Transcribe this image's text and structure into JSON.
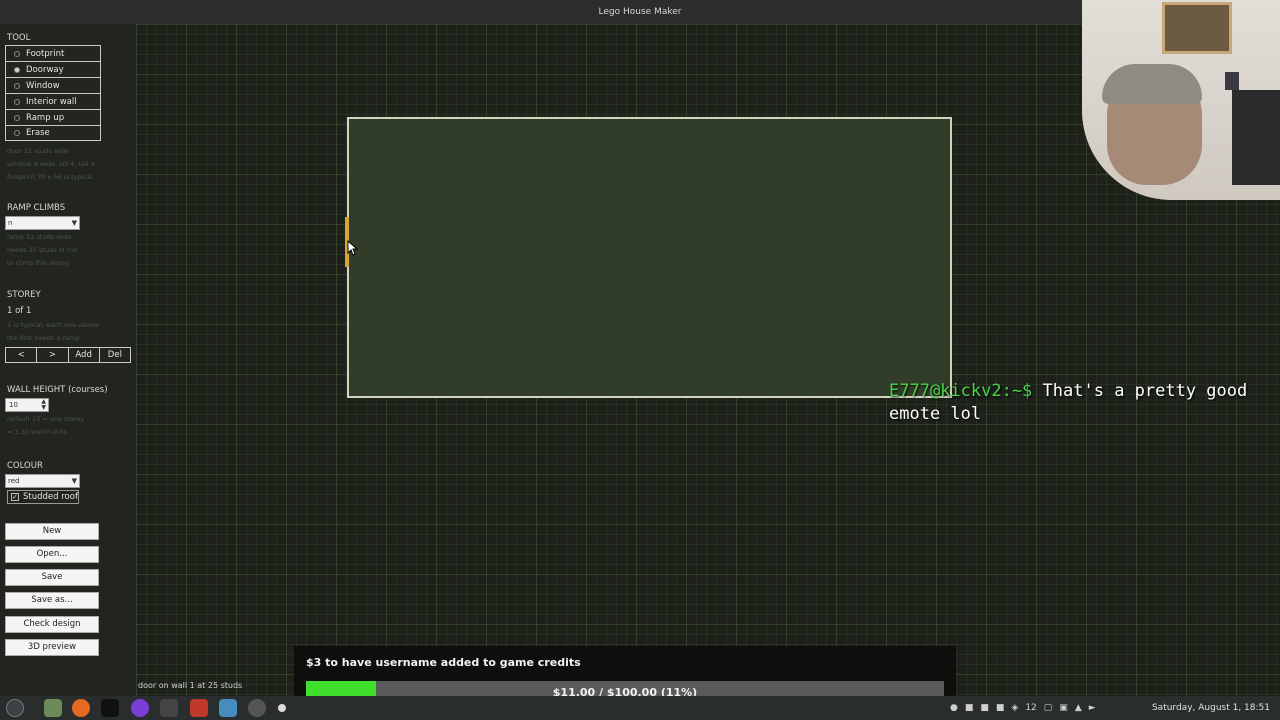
{
  "window": {
    "title": "Lego House Maker"
  },
  "tool": {
    "heading": "TOOL",
    "options": [
      {
        "label": "Footprint",
        "selected": false
      },
      {
        "label": "Doorway",
        "selected": true
      },
      {
        "label": "Window",
        "selected": false
      },
      {
        "label": "Interior wall",
        "selected": false
      },
      {
        "label": "Ramp up",
        "selected": false
      },
      {
        "label": "Erase",
        "selected": false
      }
    ],
    "hints": [
      "door 12 studs wide",
      "window 8 wide, sill 4, tall 4",
      "footprint 70 x 56 is typical"
    ]
  },
  "ramp": {
    "heading": "RAMP CLIMBS",
    "select_value": "n",
    "hints": [
      "ramp 12 studs wide",
      "needs 25 studs of run",
      "to climb this storey"
    ]
  },
  "storey": {
    "heading": "STOREY",
    "value": "1 of 1",
    "hints": [
      "2 is typical: each one above",
      "the first needs a ramp"
    ],
    "buttons": {
      "prev": "<",
      "next": ">",
      "add": "Add",
      "del": "Del"
    }
  },
  "wall_height": {
    "heading": "WALL HEIGHT (courses)",
    "value": "10",
    "hints": [
      "default 10 = one storey",
      "= 3.20 world units"
    ]
  },
  "colour": {
    "heading": "COLOUR",
    "value": "red",
    "studded_roof_label": "Studded roof",
    "studded_roof_checked": true
  },
  "actions": {
    "new": "New",
    "open": "Open...",
    "save": "Save",
    "save_as": "Save as...",
    "check": "Check design",
    "preview": "3D preview"
  },
  "status_text": "door on wall 1 at 25 studs",
  "chat": {
    "user": "E777@kickv2:~$",
    "message": "That's a pretty good emote lol"
  },
  "donation": {
    "title": "$3 to have username added to game credits",
    "progress_text": "$11.00 / $100.00 (11%)",
    "progress": 0.11,
    "fill_color": "#3ee02c"
  },
  "taskbar": {
    "tray_number": "12",
    "clock": "Saturday, August  1, 18:51"
  },
  "colors": {
    "footprint": "#323d29",
    "doorway": "#d4a63a",
    "chat_user": "#4bd34b"
  }
}
